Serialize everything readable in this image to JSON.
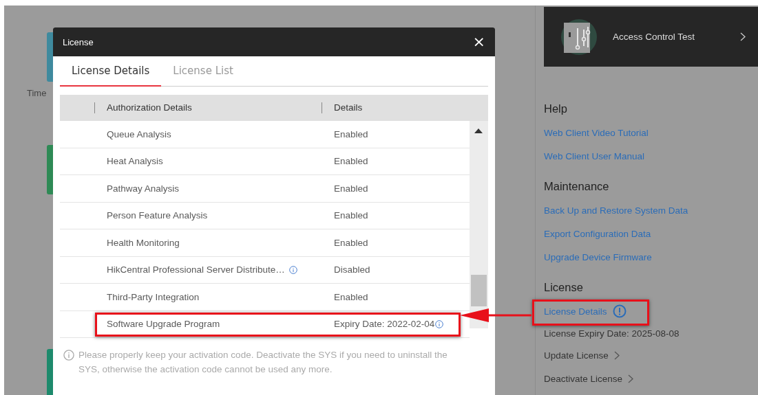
{
  "background": {
    "left_label": "Time",
    "accent_bars": [
      {
        "color": "#3f8a9e"
      },
      {
        "color": "#2e8a55"
      },
      {
        "color": "#1d8a6c"
      }
    ]
  },
  "dialog": {
    "title": "License",
    "close": "×",
    "tabs": [
      {
        "label": "License Details",
        "selected": true
      },
      {
        "label": "License List",
        "selected": false
      }
    ],
    "table": {
      "columns": [
        "Authorization Details",
        "Details"
      ],
      "rows": [
        {
          "name": "Queue Analysis",
          "details": "Enabled",
          "info": false,
          "annotated": false
        },
        {
          "name": "Heat Analysis",
          "details": "Enabled",
          "info": false,
          "annotated": false
        },
        {
          "name": "Pathway Analysis",
          "details": "Enabled",
          "info": false,
          "annotated": false
        },
        {
          "name": "Person Feature Analysis",
          "details": "Enabled",
          "info": false,
          "annotated": false
        },
        {
          "name": "Health Monitoring",
          "details": "Enabled",
          "info": false,
          "annotated": false
        },
        {
          "name": "HikCentral Professional Server Distribute…",
          "details": "Disabled",
          "info": true,
          "annotated": false
        },
        {
          "name": "Third-Party Integration",
          "details": "Enabled",
          "info": false,
          "annotated": false
        },
        {
          "name": "Software Upgrade Program",
          "details": "Expiry Date: 2022-02-04",
          "info": true,
          "annotated": true
        }
      ]
    },
    "note": "Please properly keep your activation code. Deactivate the SYS if you need to uninstall the SYS, otherwise the activation code cannot be used any more."
  },
  "annotation_arrow": true,
  "side_panel": {
    "card": {
      "title": "Access Control Test"
    },
    "sections": [
      {
        "heading": "Help",
        "items": [
          {
            "kind": "link",
            "label": "Web Client Video Tutorial",
            "info": false,
            "annotated": false
          },
          {
            "kind": "link",
            "label": "Web Client User Manual",
            "info": false,
            "annotated": false
          }
        ]
      },
      {
        "heading": "Maintenance",
        "items": [
          {
            "kind": "link",
            "label": "Back Up and Restore System Data",
            "info": false,
            "annotated": false
          },
          {
            "kind": "link",
            "label": "Export Configuration Data",
            "info": false,
            "annotated": false
          },
          {
            "kind": "link",
            "label": "Upgrade Device Firmware",
            "info": false,
            "annotated": false
          }
        ]
      },
      {
        "heading": "License",
        "items": [
          {
            "kind": "link",
            "label": "License Details",
            "info": true,
            "annotated": true
          },
          {
            "kind": "text",
            "label": "License Expiry Date: 2025-08-08",
            "info": false,
            "annotated": false
          },
          {
            "kind": "action",
            "label": "Update License",
            "info": false,
            "annotated": false
          },
          {
            "kind": "action",
            "label": "Deactivate License",
            "info": false,
            "annotated": false
          }
        ]
      }
    ]
  }
}
